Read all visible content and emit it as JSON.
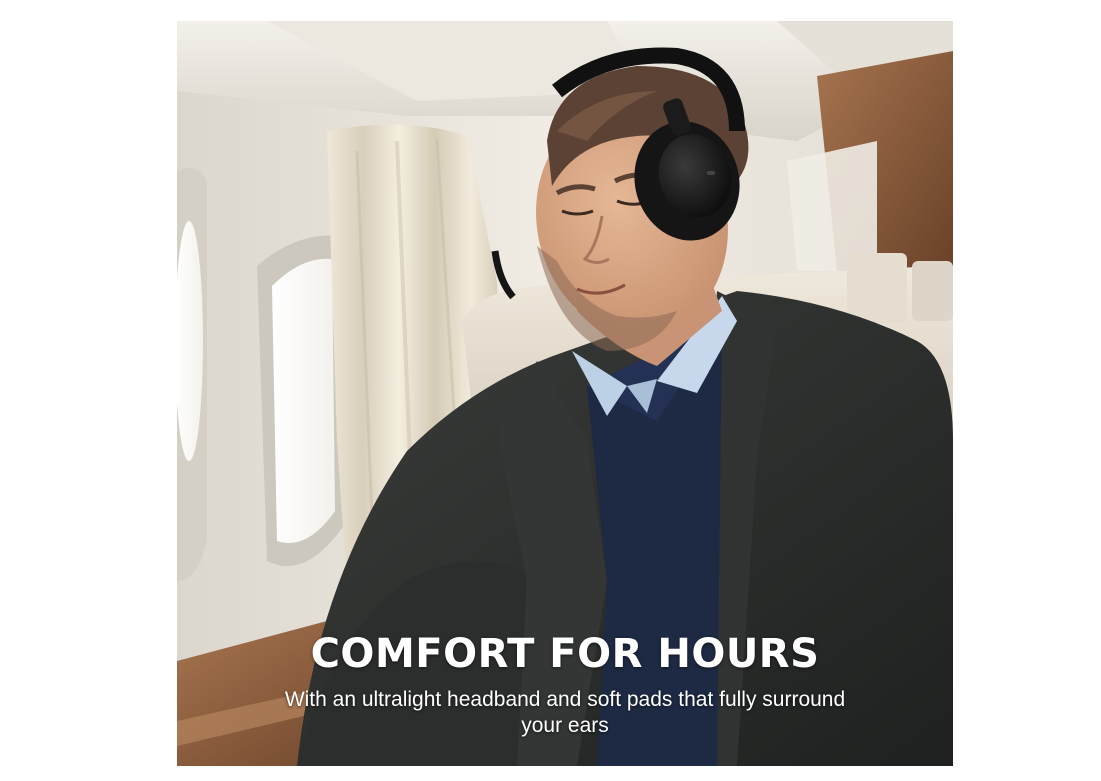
{
  "ad": {
    "headline": "COMFORT FOR HOURS",
    "subline": "With an ultralight headband and soft pads that fully surround your ears"
  },
  "colors": {
    "text": "#ffffff",
    "jacket": "#2a2d2b",
    "sweater": "#1e2a44",
    "shirt": "#bcd0e6",
    "headphones": "#141414",
    "cabin_wall": "#e9e4da",
    "wood_panel": "#8a5a3a"
  },
  "scene": {
    "subject": "man-with-headphones",
    "setting": "airplane-cabin"
  }
}
